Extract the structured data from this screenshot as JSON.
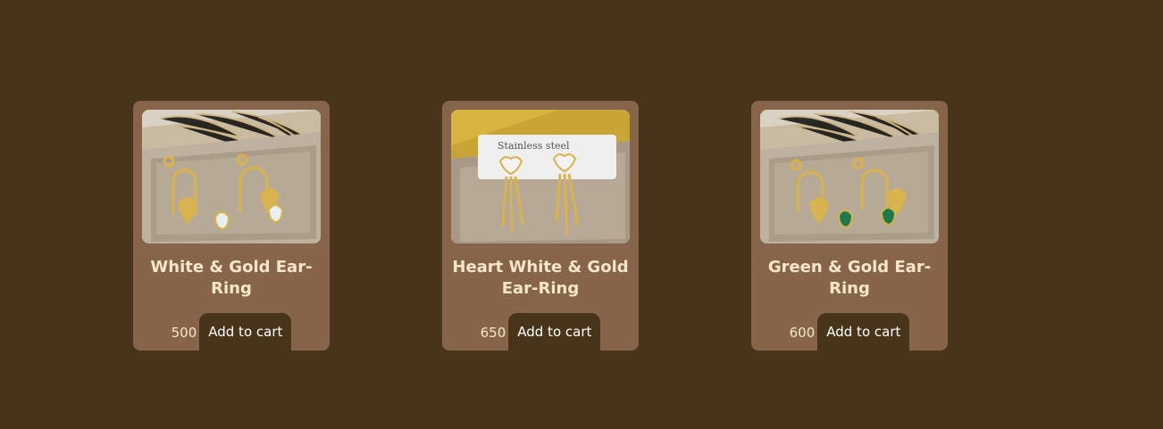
{
  "products": [
    {
      "title": "White & Gold Ear-Ring",
      "price": "500",
      "button_label": "Add to cart",
      "image_icon": "earring-photo-white-stone"
    },
    {
      "title": "Heart White & Gold Ear-Ring",
      "price": "650",
      "button_label": "Add to cart",
      "image_icon": "earring-photo-heart",
      "image_card_text": "Stainless steel"
    },
    {
      "title": "Green & Gold Ear-Ring",
      "price": "600",
      "button_label": "Add to cart",
      "image_icon": "earring-photo-green-stone"
    }
  ],
  "colors": {
    "page_background": "#473419",
    "card_background": "#87654a",
    "title_text": "#f6e7c8",
    "button_background": "#473419",
    "button_text": "#ffffff"
  }
}
